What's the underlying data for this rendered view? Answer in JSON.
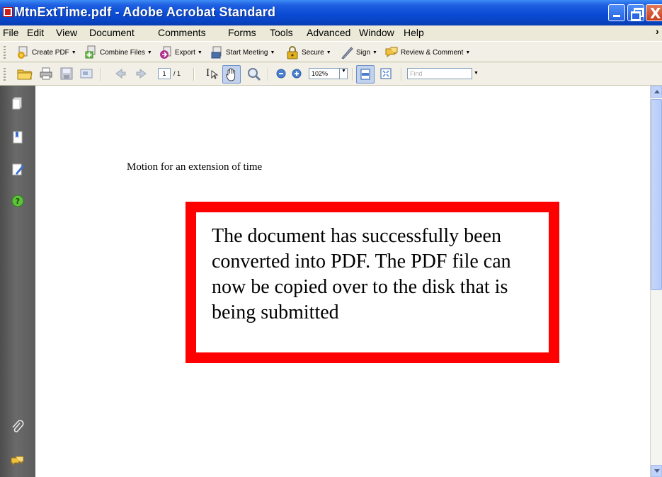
{
  "window": {
    "title": "MtnExtTime.pdf - Adobe Acrobat Standard",
    "close_glyph": "X"
  },
  "menu": {
    "items": [
      "File",
      "Edit",
      "View",
      "Document",
      "Comments",
      "Forms",
      "Tools",
      "Advanced",
      "Window",
      "Help"
    ],
    "more_glyph": "›"
  },
  "tasks_toolbar": {
    "items": [
      {
        "label": "Create PDF",
        "icon": "create-pdf-icon"
      },
      {
        "label": "Combine Files",
        "icon": "combine-files-icon"
      },
      {
        "label": "Export",
        "icon": "export-icon"
      },
      {
        "label": "Start Meeting",
        "icon": "start-meeting-icon"
      },
      {
        "label": "Secure",
        "icon": "lock-icon"
      },
      {
        "label": "Sign",
        "icon": "pen-icon"
      },
      {
        "label": "Review & Comment",
        "icon": "review-comment-icon"
      }
    ],
    "dropdown_glyph": "▼"
  },
  "nav_toolbar": {
    "current_page": "1",
    "page_count": "/ 1",
    "zoom": "102%",
    "find_placeholder": "Find",
    "select_tool_glyph": "I"
  },
  "document": {
    "heading": "Motion for an extension of time",
    "notice": "The document has successfully been converted into PDF.  The PDF file can now be copied over to the disk that is being submitted",
    "notice_border_color": "#FF0000"
  },
  "colors": {
    "titlebar": "#0B4CD6",
    "chrome": "#ECE9D8",
    "left_panel": "#5a5a5a"
  }
}
